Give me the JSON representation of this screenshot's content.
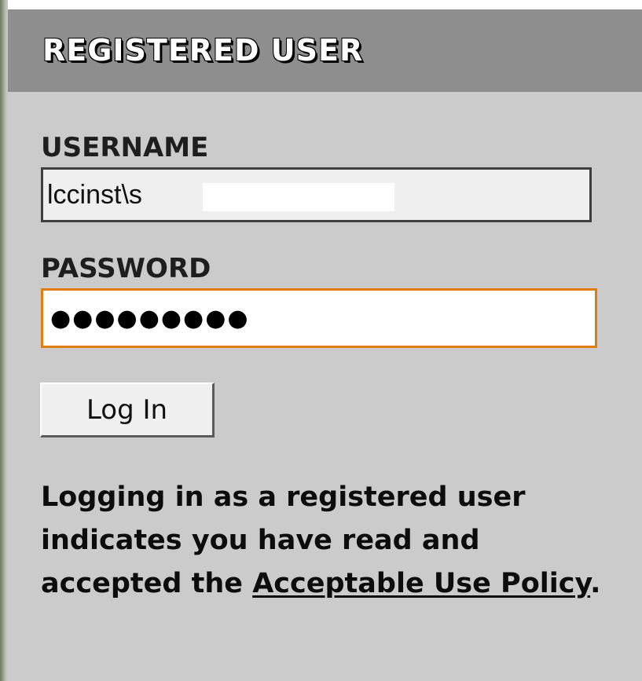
{
  "panel": {
    "title": "REGISTERED USER"
  },
  "username": {
    "label": "USERNAME",
    "value": "lccinst\\s"
  },
  "password": {
    "label": "PASSWORD",
    "value": "●●●●●●●●●"
  },
  "login_button": {
    "label": "Log In"
  },
  "notice": {
    "text": "Logging in as a registered user indicates you have read and accepted the",
    "link_label": "Acceptable Use Policy",
    "trailing": "."
  },
  "colors": {
    "header_bg": "#8e8e8e",
    "panel_bg": "#cbcbcb",
    "focus_border": "#e07d10"
  }
}
